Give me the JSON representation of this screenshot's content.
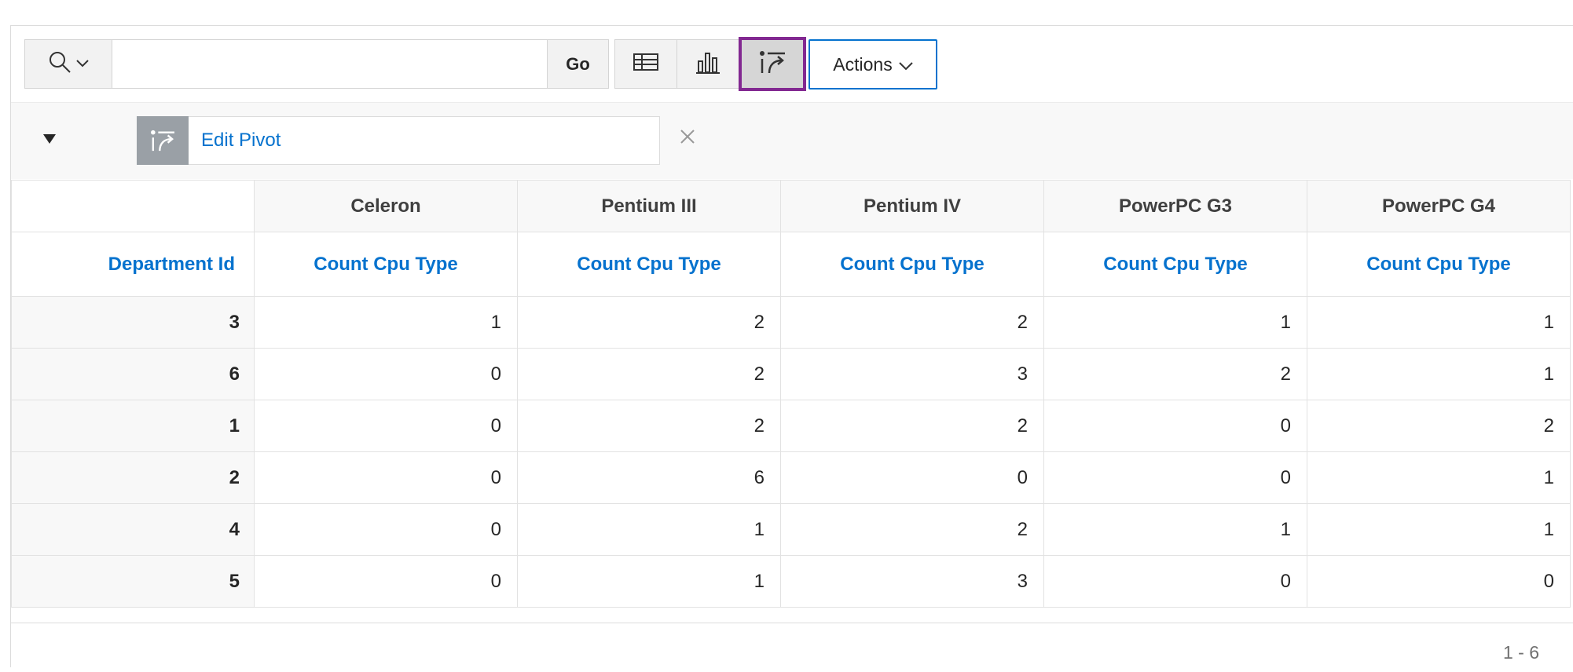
{
  "toolbar": {
    "search_value": "",
    "go_label": "Go",
    "actions_label": "Actions",
    "view_icons": [
      "report-view-icon",
      "chart-view-icon",
      "pivot-view-icon"
    ],
    "active_view": "pivot",
    "active_color": "#822891",
    "accent_color": "#0572ce"
  },
  "controls": {
    "pivot_chip_label": "Edit Pivot"
  },
  "pivot": {
    "columns": [
      "Celeron",
      "Pentium III",
      "Pentium IV",
      "PowerPC G3",
      "PowerPC G4"
    ],
    "row_header_label": "Department Id",
    "measure_label": "Count Cpu Type",
    "rows": [
      {
        "id": "3",
        "values": [
          "1",
          "2",
          "2",
          "1",
          "1"
        ]
      },
      {
        "id": "6",
        "values": [
          "0",
          "2",
          "3",
          "2",
          "1"
        ]
      },
      {
        "id": "1",
        "values": [
          "0",
          "2",
          "2",
          "0",
          "2"
        ]
      },
      {
        "id": "2",
        "values": [
          "0",
          "6",
          "0",
          "0",
          "1"
        ]
      },
      {
        "id": "4",
        "values": [
          "0",
          "1",
          "2",
          "1",
          "1"
        ]
      },
      {
        "id": "5",
        "values": [
          "0",
          "1",
          "3",
          "0",
          "0"
        ]
      }
    ]
  },
  "footer": {
    "pagination": "1 - 6"
  }
}
